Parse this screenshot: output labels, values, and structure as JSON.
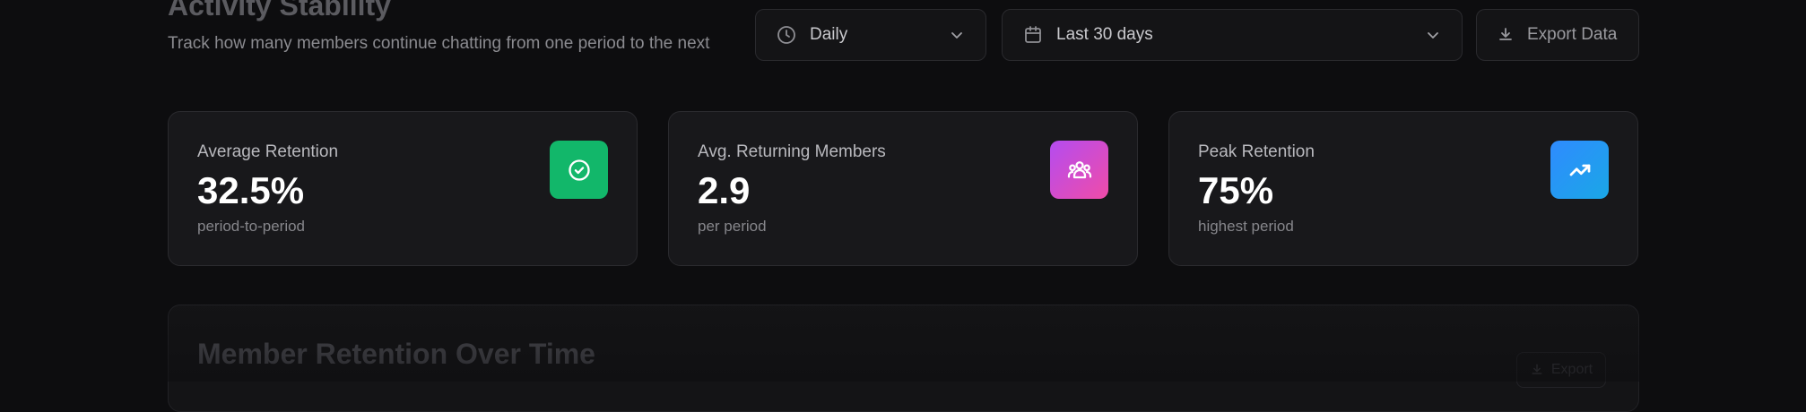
{
  "header": {
    "title": "Activity Stability",
    "subtitle": "Track how many members continue chatting from one period to the next"
  },
  "controls": {
    "period": {
      "value": "Daily",
      "icon": "clock-icon"
    },
    "range": {
      "value": "Last 30 days",
      "icon": "calendar-icon"
    },
    "export_label": "Export Data"
  },
  "cards": [
    {
      "label": "Average Retention",
      "value": "32.5%",
      "sub": "period-to-period",
      "icon": "check-circle-icon",
      "color": "#12b76a"
    },
    {
      "label": "Avg. Returning Members",
      "value": "2.9",
      "sub": "per period",
      "icon": "users-icon",
      "color": "#d24ce0"
    },
    {
      "label": "Peak Retention",
      "value": "75%",
      "sub": "highest period",
      "icon": "trending-up-icon",
      "color": "#2f8bff"
    }
  ],
  "chart_panel": {
    "title": "Member Retention Over Time",
    "export_label": "Export"
  }
}
